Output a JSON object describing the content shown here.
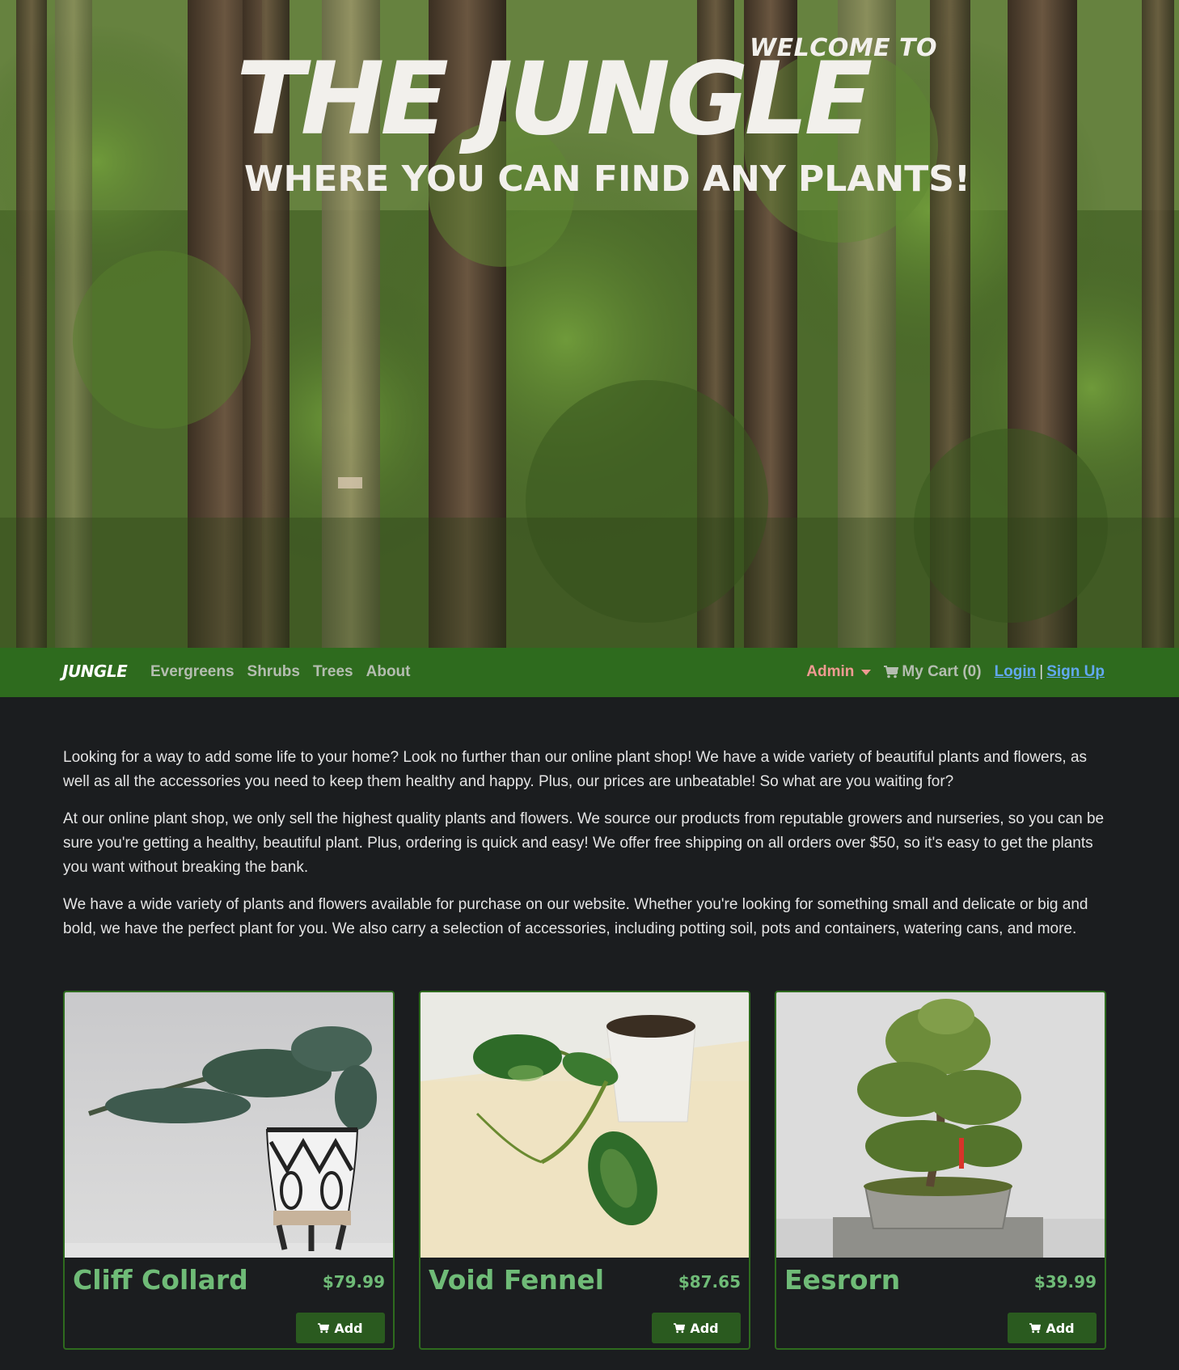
{
  "hero": {
    "welcome": "WELCOME TO",
    "title": "THE JUNGLE",
    "subtitle": "WHERE YOU CAN FIND ANY PLANTS!"
  },
  "navbar": {
    "brand": "JUNGLE",
    "links": [
      "Evergreens",
      "Shrubs",
      "Trees",
      "About"
    ],
    "admin_label": "Admin",
    "cart_label": "My Cart (0)",
    "login_label": "Login",
    "separator": "|",
    "signup_label": "Sign Up"
  },
  "intro": {
    "paragraphs": [
      "Looking for a way to add some life to your home? Look no further than our online plant shop! We have a wide variety of beautiful plants and flowers, as well as all the accessories you need to keep them healthy and happy. Plus, our prices are unbeatable! So what are you waiting for?",
      "At our online plant shop, we only sell the highest quality plants and flowers. We source our products from reputable growers and nurseries, so you can be sure you're getting a healthy, beautiful plant. Plus, ordering is quick and easy! We offer free shipping on all orders over $50, so it's easy to get the plants you want without breaking the bank.",
      "We have a wide variety of plants and flowers available for purchase on our website. Whether you're looking for something small and delicate or big and bold, we have the perfect plant for you. We also carry a selection of accessories, including potting soil, pots and containers, watering cans, and more."
    ]
  },
  "products": [
    {
      "name": "Cliff Collard",
      "price": "$79.99",
      "add_label": "Add"
    },
    {
      "name": "Void Fennel",
      "price": "$87.65",
      "add_label": "Add"
    },
    {
      "name": "Eesrorn",
      "price": "$39.99",
      "add_label": "Add"
    }
  ],
  "colors": {
    "navbar_bg": "#2e6b1e",
    "page_bg": "#1b1d1f",
    "product_text": "#6fbb77",
    "admin_text": "#ef9a92",
    "auth_link": "#62a8f0",
    "add_button_bg": "#2a5a1f"
  }
}
